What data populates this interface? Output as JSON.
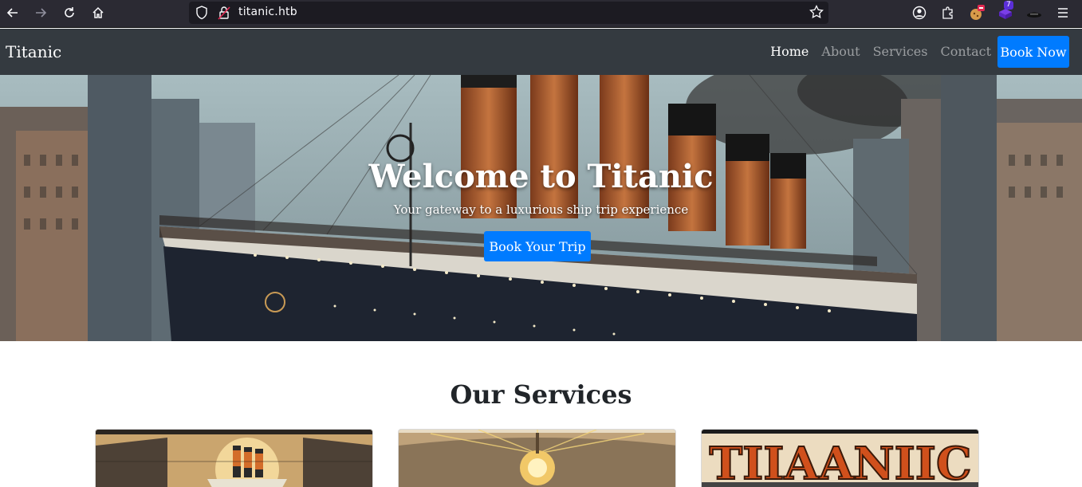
{
  "browser": {
    "url": "titanic.htb",
    "extension_badges": [
      "7"
    ]
  },
  "navbar": {
    "brand": "Titanic",
    "links": [
      {
        "label": "Home",
        "active": true
      },
      {
        "label": "About",
        "active": false
      },
      {
        "label": "Services",
        "active": false
      },
      {
        "label": "Contact",
        "active": false
      }
    ],
    "cta_label": "Book Now"
  },
  "hero": {
    "title": "Welcome to Titanic",
    "subtitle": "Your gateway to a luxurious ship trip experience",
    "cta_label": "Book Your Trip"
  },
  "services": {
    "title": "Our Services",
    "card3_poster_text": "TIIAANIIC"
  },
  "colors": {
    "primary": "#007bff",
    "navbar_bg": "#343a40",
    "chrome_bg": "#2b2a33",
    "urlbar_bg": "#1c1b22"
  }
}
